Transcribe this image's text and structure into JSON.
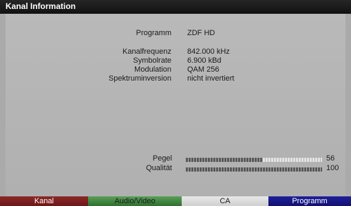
{
  "window": {
    "title": "Kanal Information"
  },
  "info": {
    "programm_label": "Programm",
    "programm_value": "ZDF HD",
    "details": [
      {
        "label": "Kanalfrequenz",
        "value": "842.000 kHz"
      },
      {
        "label": "Symbolrate",
        "value": "6.900 kBd"
      },
      {
        "label": "Modulation",
        "value": "QAM 256"
      },
      {
        "label": "Spektruminversion",
        "value": "nicht invertiert"
      }
    ]
  },
  "meters": {
    "pegel": {
      "label": "Pegel",
      "value": "56",
      "level": 0.56
    },
    "qualitaet": {
      "label": "Qualität",
      "value": "100",
      "level": 1.0
    }
  },
  "footer": {
    "buttons": [
      {
        "label": "Kanal",
        "color": "#7a1e1e"
      },
      {
        "label": "Audio/Video",
        "color": "#3f8a3f"
      },
      {
        "label": "CA",
        "color": "#dcdcdc"
      },
      {
        "label": "Programm",
        "color": "#18188a"
      }
    ]
  }
}
